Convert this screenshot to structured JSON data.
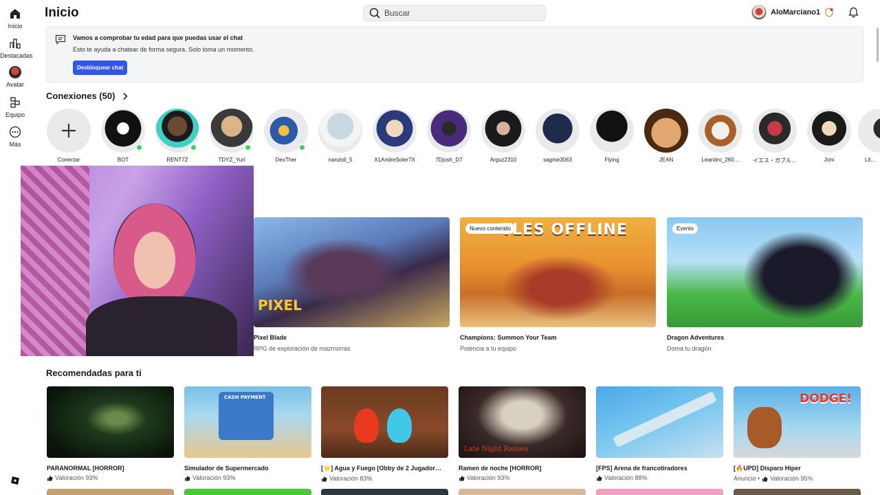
{
  "nav": {
    "items": [
      {
        "label": "Inicio",
        "icon": "home-icon"
      },
      {
        "label": "Destacadas",
        "icon": "charts-icon"
      },
      {
        "label": "Avatar",
        "icon": "avatar-icon"
      },
      {
        "label": "Equipo",
        "icon": "group-icon"
      },
      {
        "label": "Más",
        "icon": "more-icon"
      }
    ]
  },
  "header": {
    "title": "Inicio",
    "search_placeholder": "Buscar",
    "username": "AloMarciano1"
  },
  "banner": {
    "title": "Vamos a comprobar tu edad para que puedas usar el chat",
    "subtitle": "Esto te ayuda a chatear de forma segura. Solo toma un momento.",
    "button": "Desbloquear chat"
  },
  "connections": {
    "title": "Conexiones (50)",
    "items": [
      {
        "name": "Conectar",
        "online": false
      },
      {
        "name": "BOT",
        "online": true
      },
      {
        "name": "RENT7Z",
        "online": true
      },
      {
        "name": "TDYZ_Yuri",
        "online": true
      },
      {
        "name": "DexTher",
        "online": true
      },
      {
        "name": "narutoli_5",
        "online": false
      },
      {
        "name": "X1AndreSoler7X",
        "online": false
      },
      {
        "name": "7Djosh_D7",
        "online": false
      },
      {
        "name": "Arguz2310",
        "online": false
      },
      {
        "name": "sagme3063",
        "online": false
      },
      {
        "name": "Flying",
        "online": false
      },
      {
        "name": "JEAN",
        "online": false
      },
      {
        "name": "Leandro_260…",
        "online": false
      },
      {
        "name": "イエス・ガブル…",
        "online": false
      },
      {
        "name": "Joni",
        "online": false
      },
      {
        "name": "LitM…",
        "online": false
      }
    ]
  },
  "featured": [
    {
      "title": "Pixel Blade",
      "subtitle": "RPG de exploración de mazmorras",
      "tag": "",
      "thumb_text": "PIXEL"
    },
    {
      "title": "Champions: Summon Your Team",
      "subtitle": "Potencia a tu equipo",
      "tag": "Nuevo contenido",
      "thumb_text": "TLES OFFLINE"
    },
    {
      "title": "Dragon Adventures",
      "subtitle": "Doma tu dragón",
      "tag": "Evento",
      "thumb_text": ""
    }
  ],
  "recommended": {
    "title": "Recomendadas para ti",
    "items": [
      {
        "title": "PARANORMAL [HORROR]",
        "meta": "Valoración 93%",
        "ad": "",
        "thumb_text": ""
      },
      {
        "title": "Simulador de Supermercado",
        "meta": "Valoración 93%",
        "ad": "",
        "thumb_text": "CASH PAYMENT"
      },
      {
        "title": "[🌟] Agua y Fuego [Obby de 2 Jugador…",
        "meta": "Valoración 83%",
        "ad": "",
        "thumb_text": ""
      },
      {
        "title": "Ramen de noche [HORROR]",
        "meta": "Valoración 93%",
        "ad": "",
        "thumb_text": "Late Night Ramen"
      },
      {
        "title": "[FPS] Arena de francotiradores",
        "meta": "Valoración 88%",
        "ad": "",
        "thumb_text": ""
      },
      {
        "title": "[🔥UPD] Disparo Hiper",
        "meta": "Valoración 95%",
        "ad": "Anuncio •",
        "thumb_text": "DODGE!"
      }
    ]
  },
  "colors": {
    "accent": "#3355e8",
    "online": "#3ecf6a"
  }
}
